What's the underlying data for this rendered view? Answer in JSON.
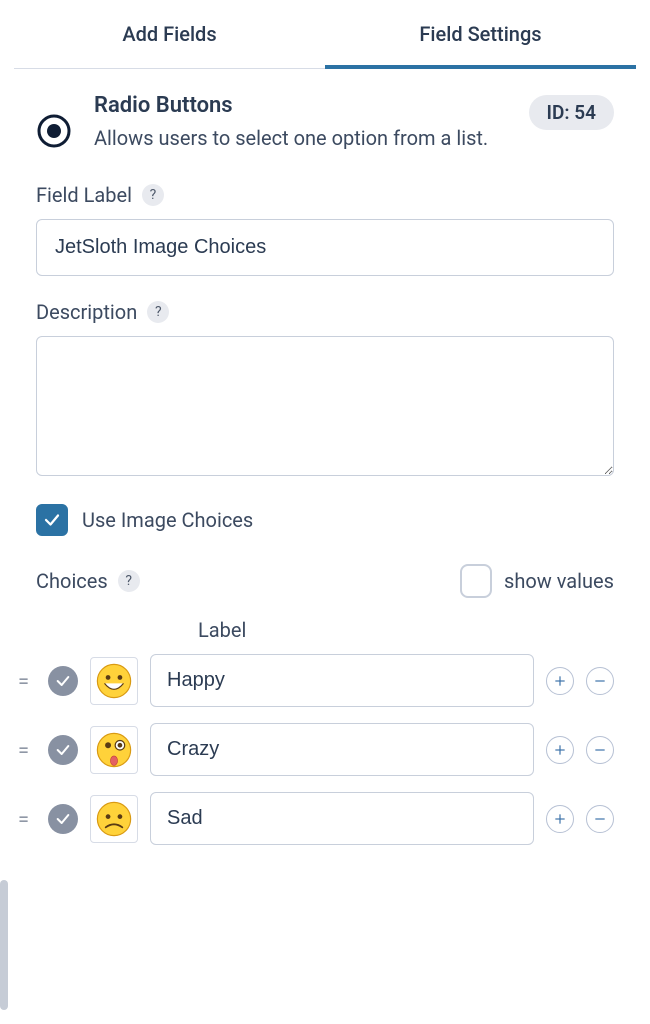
{
  "tabs": {
    "add_fields": "Add Fields",
    "field_settings": "Field Settings"
  },
  "header": {
    "title": "Radio Buttons",
    "description": "Allows users to select one option from a list.",
    "id_label": "ID: 54"
  },
  "field_label": {
    "label": "Field Label",
    "value": "JetSloth Image Choices"
  },
  "description_field": {
    "label": "Description",
    "value": ""
  },
  "use_image_choices": {
    "label": "Use Image Choices",
    "checked": true
  },
  "choices_section": {
    "label": "Choices",
    "show_values_label": "show values",
    "column_header": "Label"
  },
  "choices": [
    {
      "label": "Happy",
      "emoji": "happy"
    },
    {
      "label": "Crazy",
      "emoji": "crazy"
    },
    {
      "label": "Sad",
      "emoji": "sad"
    }
  ],
  "help_glyph": "?"
}
